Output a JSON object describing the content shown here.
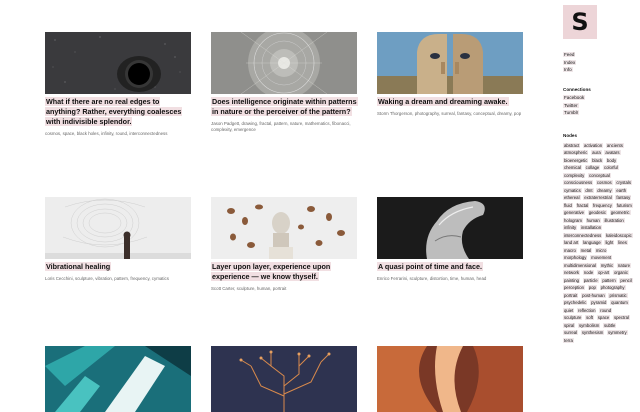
{
  "cards": [
    {
      "title": "What if there are no real edges to anything? Rather, everything coalesces with indivisible splendor.",
      "tags": "cosmos, space, black holes, infinity, round, interconnectedness"
    },
    {
      "title": "Does intelligence originate within patterns in nature or the perceiver of the pattern?",
      "tags": "Jason Padgett, drawing, fractal, pattern, nature, mathematics, fibonacci, complexity, emergence"
    },
    {
      "title": "Waking a dream and dreaming awake.",
      "tags": "Storm Thorgerson, photography, surreal, fantasy, conceptual, dreamy, pop"
    },
    {
      "title": "Vibrational healing",
      "tags": "Loris Cecchini, sculpture, vibration, pattern, frequency, cymatics"
    },
    {
      "title": "Layer upon layer, experience upon experience — we know thyself.",
      "tags": "Scott Carter, sculpture, human, portrait"
    },
    {
      "title": "A quasi point of time and face.",
      "tags": "Enrico Ferrarini, sculpture, distortion, time, human, head"
    },
    {
      "title": "",
      "tags": ""
    },
    {
      "title": "",
      "tags": ""
    },
    {
      "title": "",
      "tags": ""
    }
  ],
  "logo": "S",
  "nav": [
    "Feed",
    "Index",
    "Info"
  ],
  "connections": {
    "heading": "Connections",
    "items": [
      "Facebook",
      "Twitter",
      "Tumblr"
    ]
  },
  "nodes": {
    "heading": "Nodes",
    "items": [
      "abstract",
      "activation",
      "ancients",
      "atmospheric",
      "aura",
      "avatars",
      "bioenergetic",
      "black",
      "body",
      "chemical",
      "collage",
      "colorful",
      "complexity",
      "conceptual",
      "consciousness",
      "cosmos",
      "crystals",
      "cymatics",
      "dmt",
      "dreamy",
      "earth",
      "ethereal",
      "extraterrestrial",
      "fantasy",
      "fluid",
      "fractal",
      "frequency",
      "futurism",
      "generative",
      "geodesic",
      "geometric",
      "hologram",
      "human",
      "illustration",
      "infinity",
      "installation",
      "interconnectedness",
      "kaleidoscopic",
      "land art",
      "language",
      "light",
      "lines",
      "macro",
      "metal",
      "micro",
      "morphology",
      "movement",
      "multidimensional",
      "mythic",
      "nature",
      "network",
      "node",
      "op-art",
      "organic",
      "painting",
      "particle",
      "pattern",
      "pencil",
      "perception",
      "pop",
      "photography",
      "portrait",
      "post-human",
      "prismatic",
      "psychedelic",
      "pyramid",
      "quantum",
      "quiet",
      "reflection",
      "round",
      "sculpture",
      "soft",
      "space",
      "spectral",
      "spiral",
      "symbolism",
      "subtle",
      "surreal",
      "synthesism",
      "symmetry",
      "terra"
    ]
  }
}
